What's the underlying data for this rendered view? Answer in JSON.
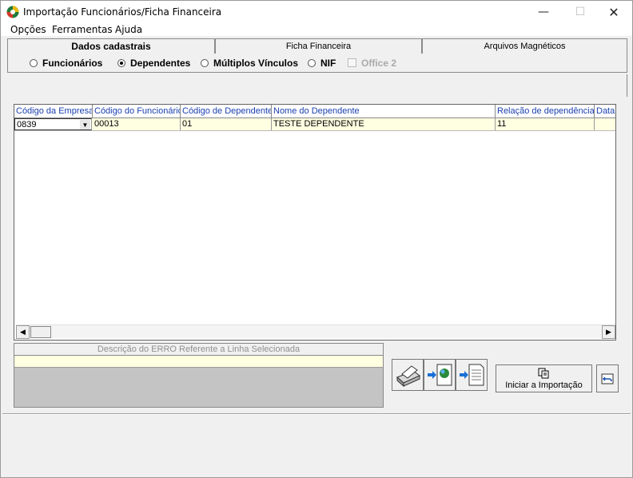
{
  "window": {
    "title": "Importação Funcionários/Ficha Financeira"
  },
  "menu": [
    "Opções",
    "Ferramentas",
    "Ajuda"
  ],
  "tabs": [
    "Dados cadastrais",
    "Ficha Financeira",
    "Arquivos Magnéticos"
  ],
  "options": {
    "radios": [
      "Funcionários",
      "Dependentes",
      "Múltiplos Vínculos",
      "NIF"
    ],
    "selected": "Dependentes",
    "checkbox": "Office 2"
  },
  "grid": {
    "headers": [
      "Código da Empresa",
      "Código do Funcionário",
      "Código de Dependente",
      "Nome do Dependente",
      "Relação de dependência",
      "Data"
    ],
    "rows": [
      [
        "0839",
        "00013",
        "01",
        "TESTE DEPENDENTE",
        "11",
        ""
      ]
    ]
  },
  "error_panel": {
    "header": "Descrição do ERRO Referente a Linha Selecionada"
  },
  "buttons": {
    "start_import": "Iniciar a Importação"
  },
  "icons": [
    "app-icon",
    "printer-icon",
    "export-web-icon",
    "export-document-icon",
    "copy-icon",
    "undo-icon"
  ]
}
